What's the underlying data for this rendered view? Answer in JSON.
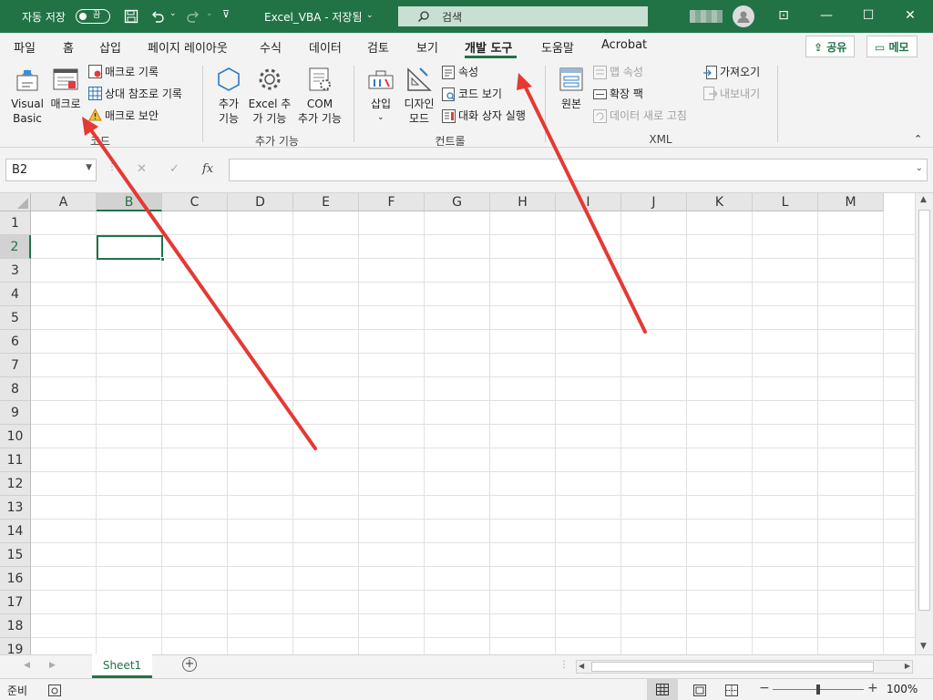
{
  "title_bar": {
    "autosave_label": "자동 저장",
    "autosave_state": "끔",
    "filename": "Excel_VBA - 저장됨",
    "search_placeholder": "검색"
  },
  "tabs": [
    "파일",
    "홈",
    "삽입",
    "페이지 레이아웃",
    "수식",
    "데이터",
    "검토",
    "보기",
    "개발 도구",
    "도움말",
    "Acrobat"
  ],
  "active_tab": "개발 도구",
  "top_right": {
    "share": "공유",
    "comments": "메모"
  },
  "ribbon": {
    "code": {
      "group": "코드",
      "visual_basic": [
        "Visual",
        "Basic"
      ],
      "macro": "매크로",
      "record_macro": "매크로 기록",
      "relative_ref": "상대 참조로 기록",
      "macro_security": "매크로 보안"
    },
    "addins": {
      "group": "추가 기능",
      "addins": [
        "추가",
        "기능"
      ],
      "excel_addins": [
        "Excel 추",
        "가 기능"
      ],
      "com_addins": [
        "COM",
        "추가 기능"
      ]
    },
    "controls": {
      "group": "컨트롤",
      "insert": "삽입",
      "design_mode": [
        "디자인",
        "모드"
      ],
      "properties": "속성",
      "view_code": "코드 보기",
      "run_dialog": "대화 상자 실행"
    },
    "xml": {
      "group": "XML",
      "source": "원본",
      "map_properties": "맵 속성",
      "expansion_packs": "확장 팩",
      "refresh_data": "데이터 새로 고침",
      "import": "가져오기",
      "export": "내보내기"
    }
  },
  "formula_bar": {
    "name_box": "B2",
    "fx": "fx",
    "value": ""
  },
  "columns": [
    "A",
    "B",
    "C",
    "D",
    "E",
    "F",
    "G",
    "H",
    "I",
    "J",
    "K",
    "L",
    "M"
  ],
  "rows": [
    "1",
    "2",
    "3",
    "4",
    "5",
    "6",
    "7",
    "8",
    "9",
    "10",
    "11",
    "12",
    "13",
    "14",
    "15",
    "16",
    "17",
    "18",
    "19"
  ],
  "selected_cell": "B2",
  "sheets": [
    "Sheet1"
  ],
  "status": {
    "mode": "준비",
    "zoom": "100%"
  },
  "colors": {
    "accent": "#217346",
    "arrow": "#e53935"
  }
}
